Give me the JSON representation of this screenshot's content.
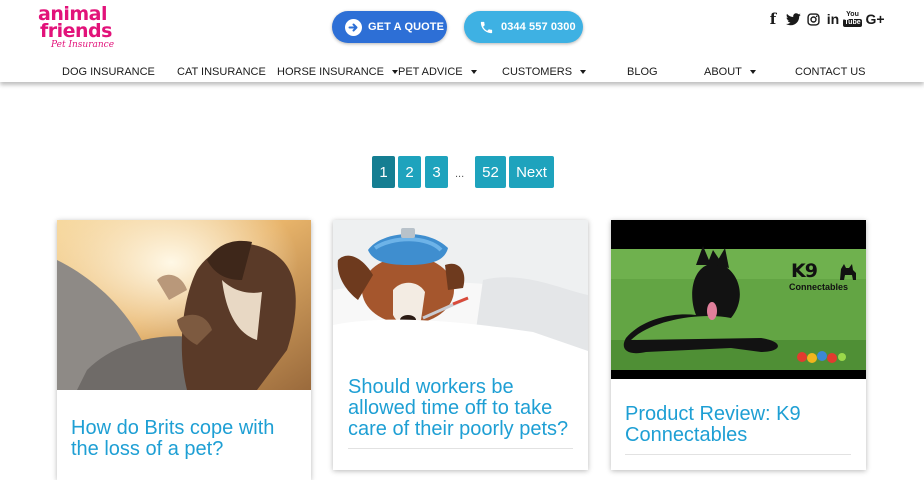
{
  "brand": {
    "line1": "animal",
    "line2": "friends",
    "tagline": "Pet Insurance",
    "color": "#e2127a"
  },
  "header": {
    "quote_button": {
      "label": "GET A QUOTE",
      "icon": "arrow-circle-icon",
      "color": "#2d6fd6"
    },
    "phone_button": {
      "label": "0344 557 0300",
      "icon": "phone-icon",
      "color": "#3eb1e3"
    },
    "social": [
      {
        "name": "facebook",
        "glyph": "f"
      },
      {
        "name": "twitter",
        "glyph": "twitter-bird"
      },
      {
        "name": "instagram",
        "glyph": "camera"
      },
      {
        "name": "linkedin",
        "glyph": "in"
      },
      {
        "name": "youtube",
        "glyph": "You Tube"
      },
      {
        "name": "google-plus",
        "glyph": "G+"
      }
    ]
  },
  "nav": {
    "items": [
      {
        "label": "DOG INSURANCE",
        "dropdown": false
      },
      {
        "label": "CAT INSURANCE",
        "dropdown": false
      },
      {
        "label": "HORSE INSURANCE",
        "dropdown": true
      },
      {
        "label": "PET ADVICE",
        "dropdown": true
      },
      {
        "label": "CUSTOMERS",
        "dropdown": true
      },
      {
        "label": "BLOG",
        "dropdown": false
      },
      {
        "label": "ABOUT",
        "dropdown": true
      },
      {
        "label": "CONTACT US",
        "dropdown": false
      }
    ]
  },
  "pagination": {
    "pages": [
      "1",
      "2",
      "3"
    ],
    "ellipsis": "...",
    "last": "52",
    "next": "Next",
    "current": "1",
    "color": "#1ea3bd",
    "active_color": "#157e92"
  },
  "posts": [
    {
      "title": "How do Brits cope with the loss of a pet?",
      "image": "person-hugging-dog-photo"
    },
    {
      "title": "Should workers be allowed time off to take care of their poorly pets?",
      "image": "sick-dog-with-ice-pack-photo"
    },
    {
      "title": "Product Review: K9 Connectables",
      "image": "black-dog-on-grass-photo",
      "image_logo_line1": "K9",
      "image_logo_line2": "Connectables"
    }
  ],
  "colors": {
    "title_blue": "#1e9fd4"
  }
}
